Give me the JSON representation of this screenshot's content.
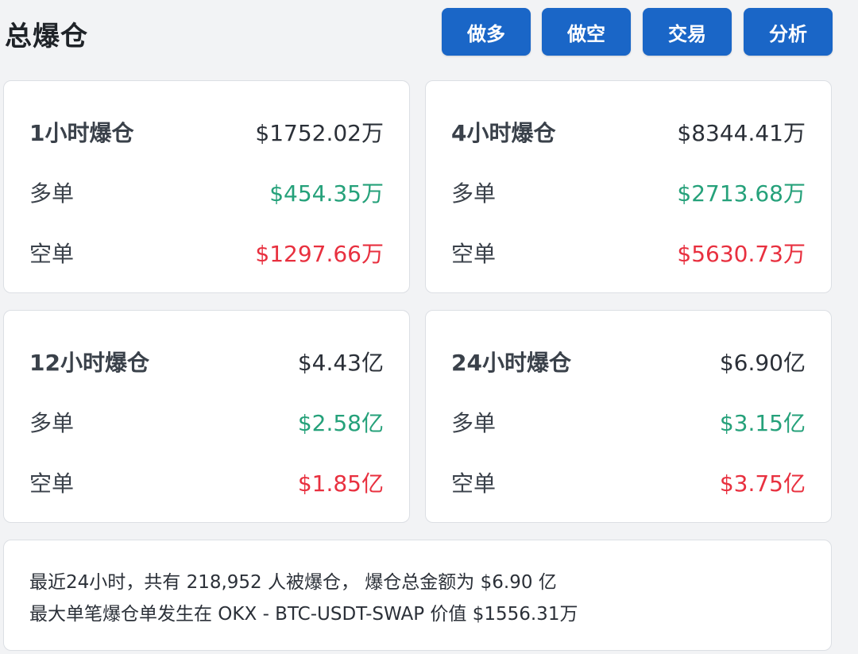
{
  "header": {
    "title": "总爆仓",
    "buttons": [
      "做多",
      "做空",
      "交易",
      "分析"
    ]
  },
  "cards": [
    {
      "title": "1小时爆仓",
      "total": "$1752.02万",
      "long_label": "多单",
      "long": "$454.35万",
      "short_label": "空单",
      "short": "$1297.66万"
    },
    {
      "title": "4小时爆仓",
      "total": "$8344.41万",
      "long_label": "多单",
      "long": "$2713.68万",
      "short_label": "空单",
      "short": "$5630.73万"
    },
    {
      "title": "12小时爆仓",
      "total": "$4.43亿",
      "long_label": "多单",
      "long": "$2.58亿",
      "short_label": "空单",
      "short": "$1.85亿"
    },
    {
      "title": "24小时爆仓",
      "total": "$6.90亿",
      "long_label": "多单",
      "long": "$3.15亿",
      "short_label": "空单",
      "short": "$3.75亿"
    }
  ],
  "summary": {
    "line1": "最近24小时，共有 218,952 人被爆仓， 爆仓总金额为 $6.90 亿",
    "line2": "最大单笔爆仓单发生在 OKX - BTC-USDT-SWAP 价值 $1556.31万"
  },
  "colors": {
    "accent": "#1a66c7",
    "long": "#25a17a",
    "short": "#e8303f"
  }
}
